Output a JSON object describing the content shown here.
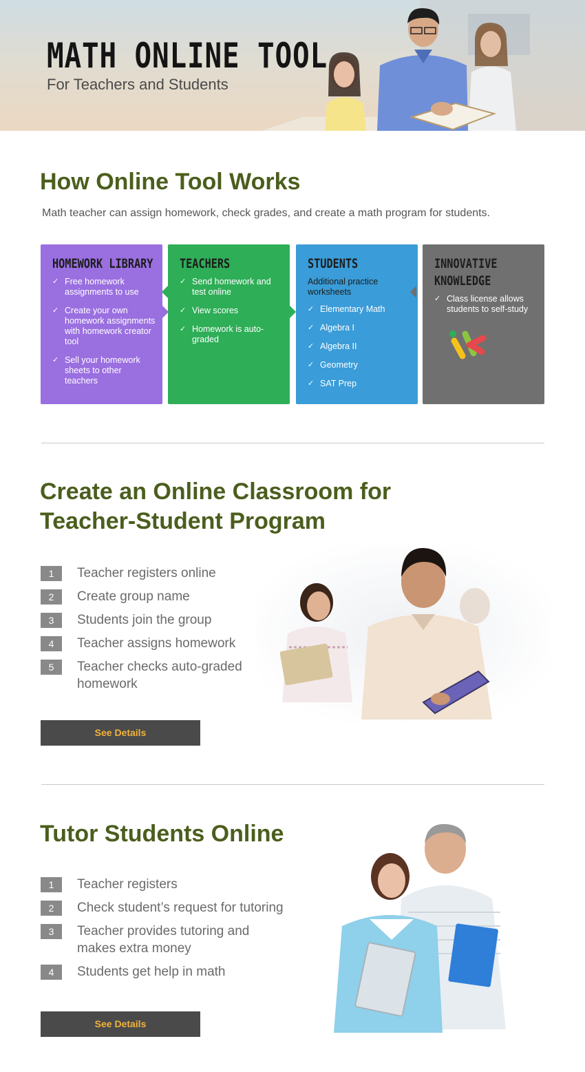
{
  "hero": {
    "title": "MATH ONLINE TOOL",
    "subtitle": "For Teachers and Students"
  },
  "how": {
    "heading": "How Online Tool Works",
    "intro": "Math teacher can assign homework, check grades, and create a math program for students."
  },
  "cards": {
    "homework": {
      "title": "HOMEWORK LIBRARY",
      "items": [
        "Free homework assignments to use",
        "Create your own homework assignments with homework creator tool",
        "Sell your homework sheets to other teachers"
      ]
    },
    "teachers": {
      "title": "TEACHERS",
      "items": [
        "Send homework and test online",
        "View scores",
        "Homework is auto-graded"
      ]
    },
    "students": {
      "title": "STUDENTS",
      "note": "Additional practice worksheets",
      "items": [
        "Elementary Math",
        "Algebra I",
        "Algebra II",
        "Geometry",
        "SAT Prep"
      ]
    },
    "innovative": {
      "title_line1": "INNOVATIVE",
      "title_line2": "KNOWLEDGE",
      "items": [
        "Class license allows students to self-study"
      ]
    }
  },
  "classroom": {
    "heading_line1": "Create an Online Classroom for",
    "heading_line2": "Teacher-Student Program",
    "steps": [
      {
        "num": "1",
        "text": "Teacher registers online"
      },
      {
        "num": "2",
        "text": "Create group name"
      },
      {
        "num": "3",
        "text": "Students join the group"
      },
      {
        "num": "4",
        "text": "Teacher assigns homework"
      },
      {
        "num": "5",
        "text": "Teacher checks auto-graded homework"
      }
    ],
    "button": "See Details"
  },
  "tutor": {
    "heading": "Tutor Students Online",
    "steps": [
      {
        "num": "1",
        "text": "Teacher registers"
      },
      {
        "num": "2",
        "text": "Check student’s request for tutoring"
      },
      {
        "num": "3",
        "text": "Teacher provides tutoring and makes extra money"
      },
      {
        "num": "4",
        "text": "Students get help in math"
      }
    ],
    "button": "See Details"
  },
  "colors": {
    "heading": "#4b5e1d",
    "purple": "#9a6fe0",
    "green": "#2eae57",
    "blue": "#3a9cd8",
    "gray": "#707070",
    "button_text": "#f3b23a"
  }
}
